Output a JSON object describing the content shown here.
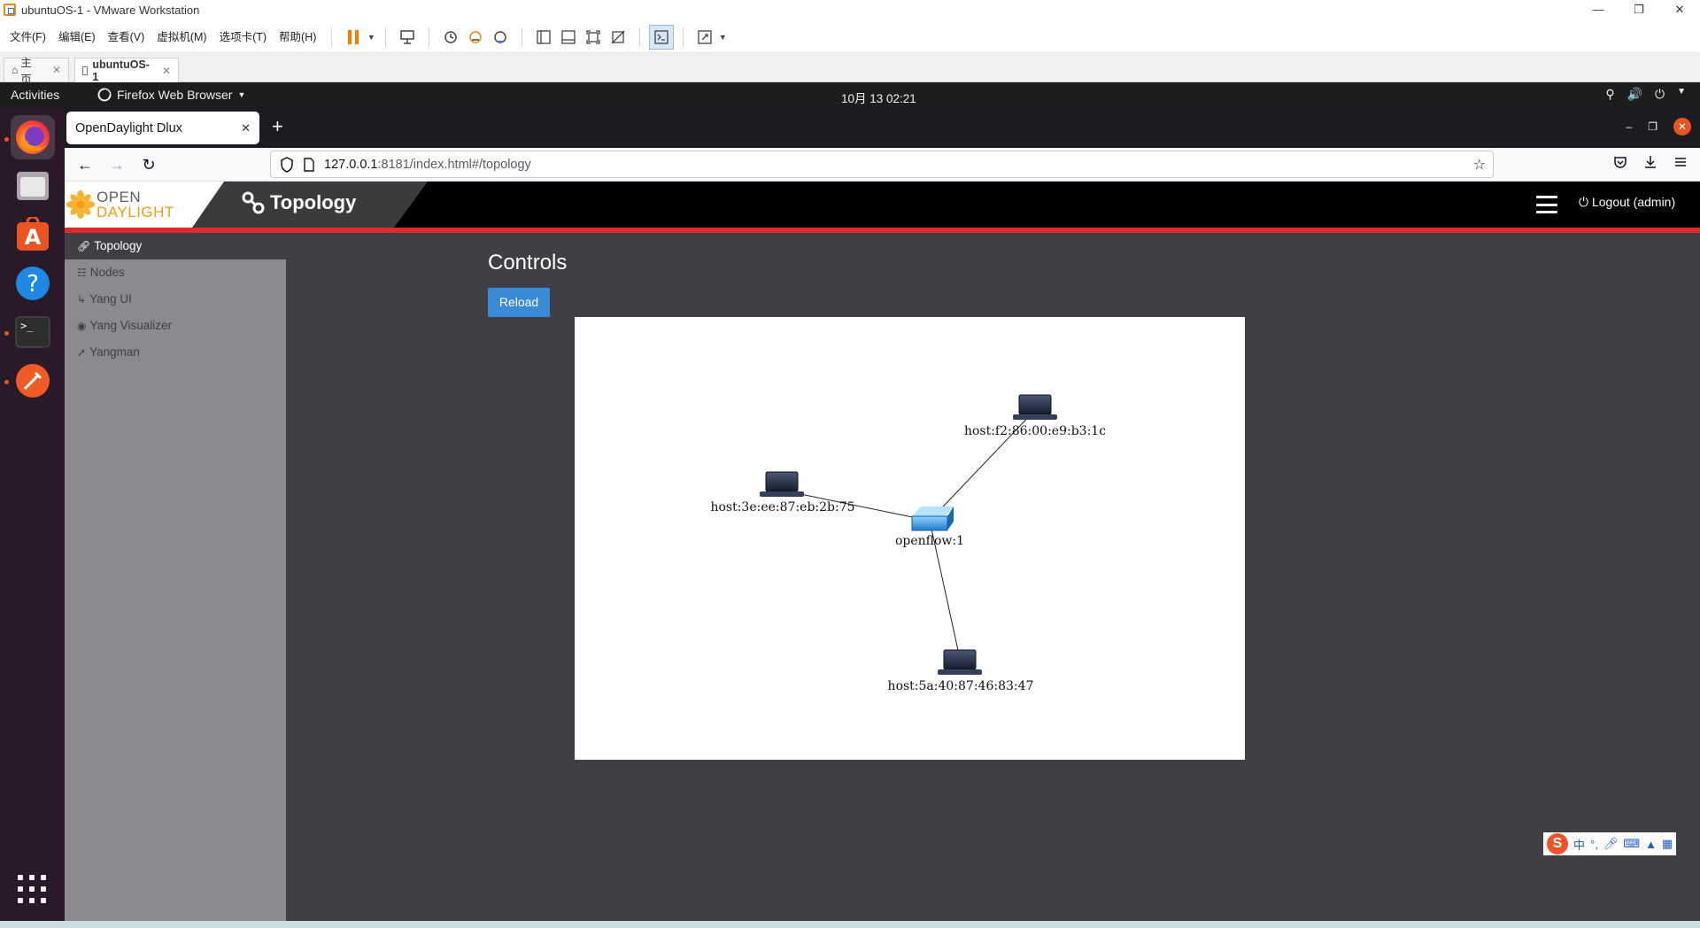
{
  "vmware": {
    "window_title": "ubuntuOS-1 - VMware Workstation",
    "menu": [
      "文件(F)",
      "编辑(E)",
      "查看(V)",
      "虚拟机(M)",
      "选项卡(T)",
      "帮助(H)"
    ],
    "tabs": [
      {
        "label": "主页"
      },
      {
        "label": "ubuntuOS-1"
      }
    ],
    "accent": "#ff7a00"
  },
  "ubuntu": {
    "activities": "Activities",
    "app_menu": "Firefox Web Browser",
    "clock": "10月 13  02:21",
    "dock_accent": "#e95420"
  },
  "firefox": {
    "tab_title": "OpenDaylight Dlux",
    "url_host": "127.0.0.1",
    "url_rest": ":8181/index.html#/topology"
  },
  "odl": {
    "logo_line1": "OPEN",
    "logo_line2": "DAYLIGHT",
    "page_title": "Topology",
    "logout": "Logout (admin)",
    "sidebar": [
      {
        "label": "Topology",
        "icon": "link-icon"
      },
      {
        "label": "Nodes",
        "icon": "sitemap-icon"
      },
      {
        "label": "Yang UI",
        "icon": "level-down-icon"
      },
      {
        "label": "Yang Visualizer",
        "icon": "eye-icon"
      },
      {
        "label": "Yangman",
        "icon": "rocket-icon"
      }
    ],
    "controls_title": "Controls",
    "reload_label": "Reload",
    "header_red": "#e12b2b",
    "button_blue": "#3a8ad8"
  },
  "topology": {
    "switch": {
      "label": "openflow:1"
    },
    "hosts": [
      {
        "label": "host:f2:86:00:e9:b3:1c"
      },
      {
        "label": "host:3e:ee:87:eb:2b:75"
      },
      {
        "label": "host:5a:40:87:46:83:47"
      }
    ]
  },
  "ime": {
    "lang": "中"
  }
}
